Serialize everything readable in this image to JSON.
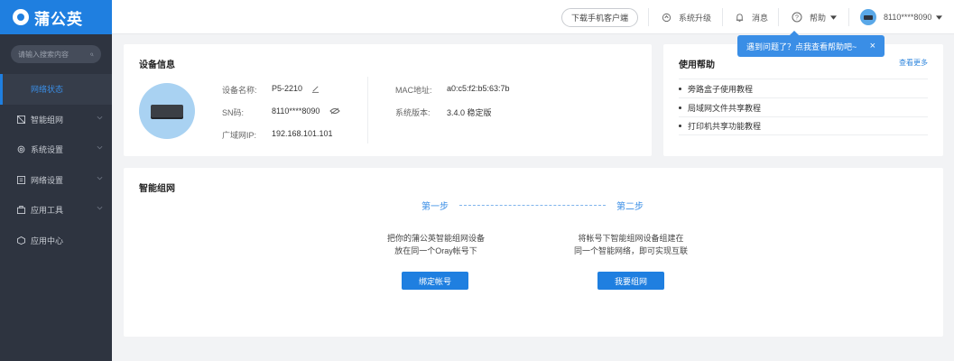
{
  "sidebar": {
    "logo_text": "蒲公英",
    "search_placeholder": "请输入搜索内容",
    "items": [
      {
        "label": "网络状态",
        "active": true
      },
      {
        "label": "智能组网"
      },
      {
        "label": "系统设置"
      },
      {
        "label": "网络设置"
      },
      {
        "label": "应用工具"
      },
      {
        "label": "应用中心"
      }
    ]
  },
  "topbar": {
    "download_label": "下载手机客户端",
    "upgrade_label": "系统升级",
    "messages_label": "消息",
    "help_label": "帮助",
    "user_label": "8110****8090"
  },
  "tooltip": {
    "text": "遇到问题了？点我查看帮助吧~",
    "close": "×"
  },
  "device_info": {
    "title": "设备信息",
    "name_label": "设备名称:",
    "name_value": "P5-2210",
    "sn_label": "SN码:",
    "sn_value": "8110****8090",
    "wan_ip_label": "广域网IP:",
    "wan_ip_value": "192.168.101.101",
    "mac_label": "MAC地址:",
    "mac_value": "a0:c5:f2:b5:63:7b",
    "version_label": "系统版本:",
    "version_value": "3.4.0 稳定版"
  },
  "help_panel": {
    "title": "使用帮助",
    "more_link": "查看更多",
    "items": [
      "旁路盒子使用教程",
      "局域网文件共享教程",
      "打印机共享功能教程"
    ]
  },
  "smart_network": {
    "title": "智能组网",
    "step1_title": "第一步",
    "step2_title": "第二步",
    "step1_line1": "把你的蒲公英智能组网设备",
    "step1_line2": "放在同一个Oray帐号下",
    "step2_line1": "将帐号下智能组网设备组建在",
    "step2_line2": "同一个智能网络，即可实现互联",
    "step1_button": "绑定帐号",
    "step2_button": "我要组网"
  },
  "colors": {
    "accent": "#1f7fe0",
    "sidebar_bg": "#2e3440"
  }
}
